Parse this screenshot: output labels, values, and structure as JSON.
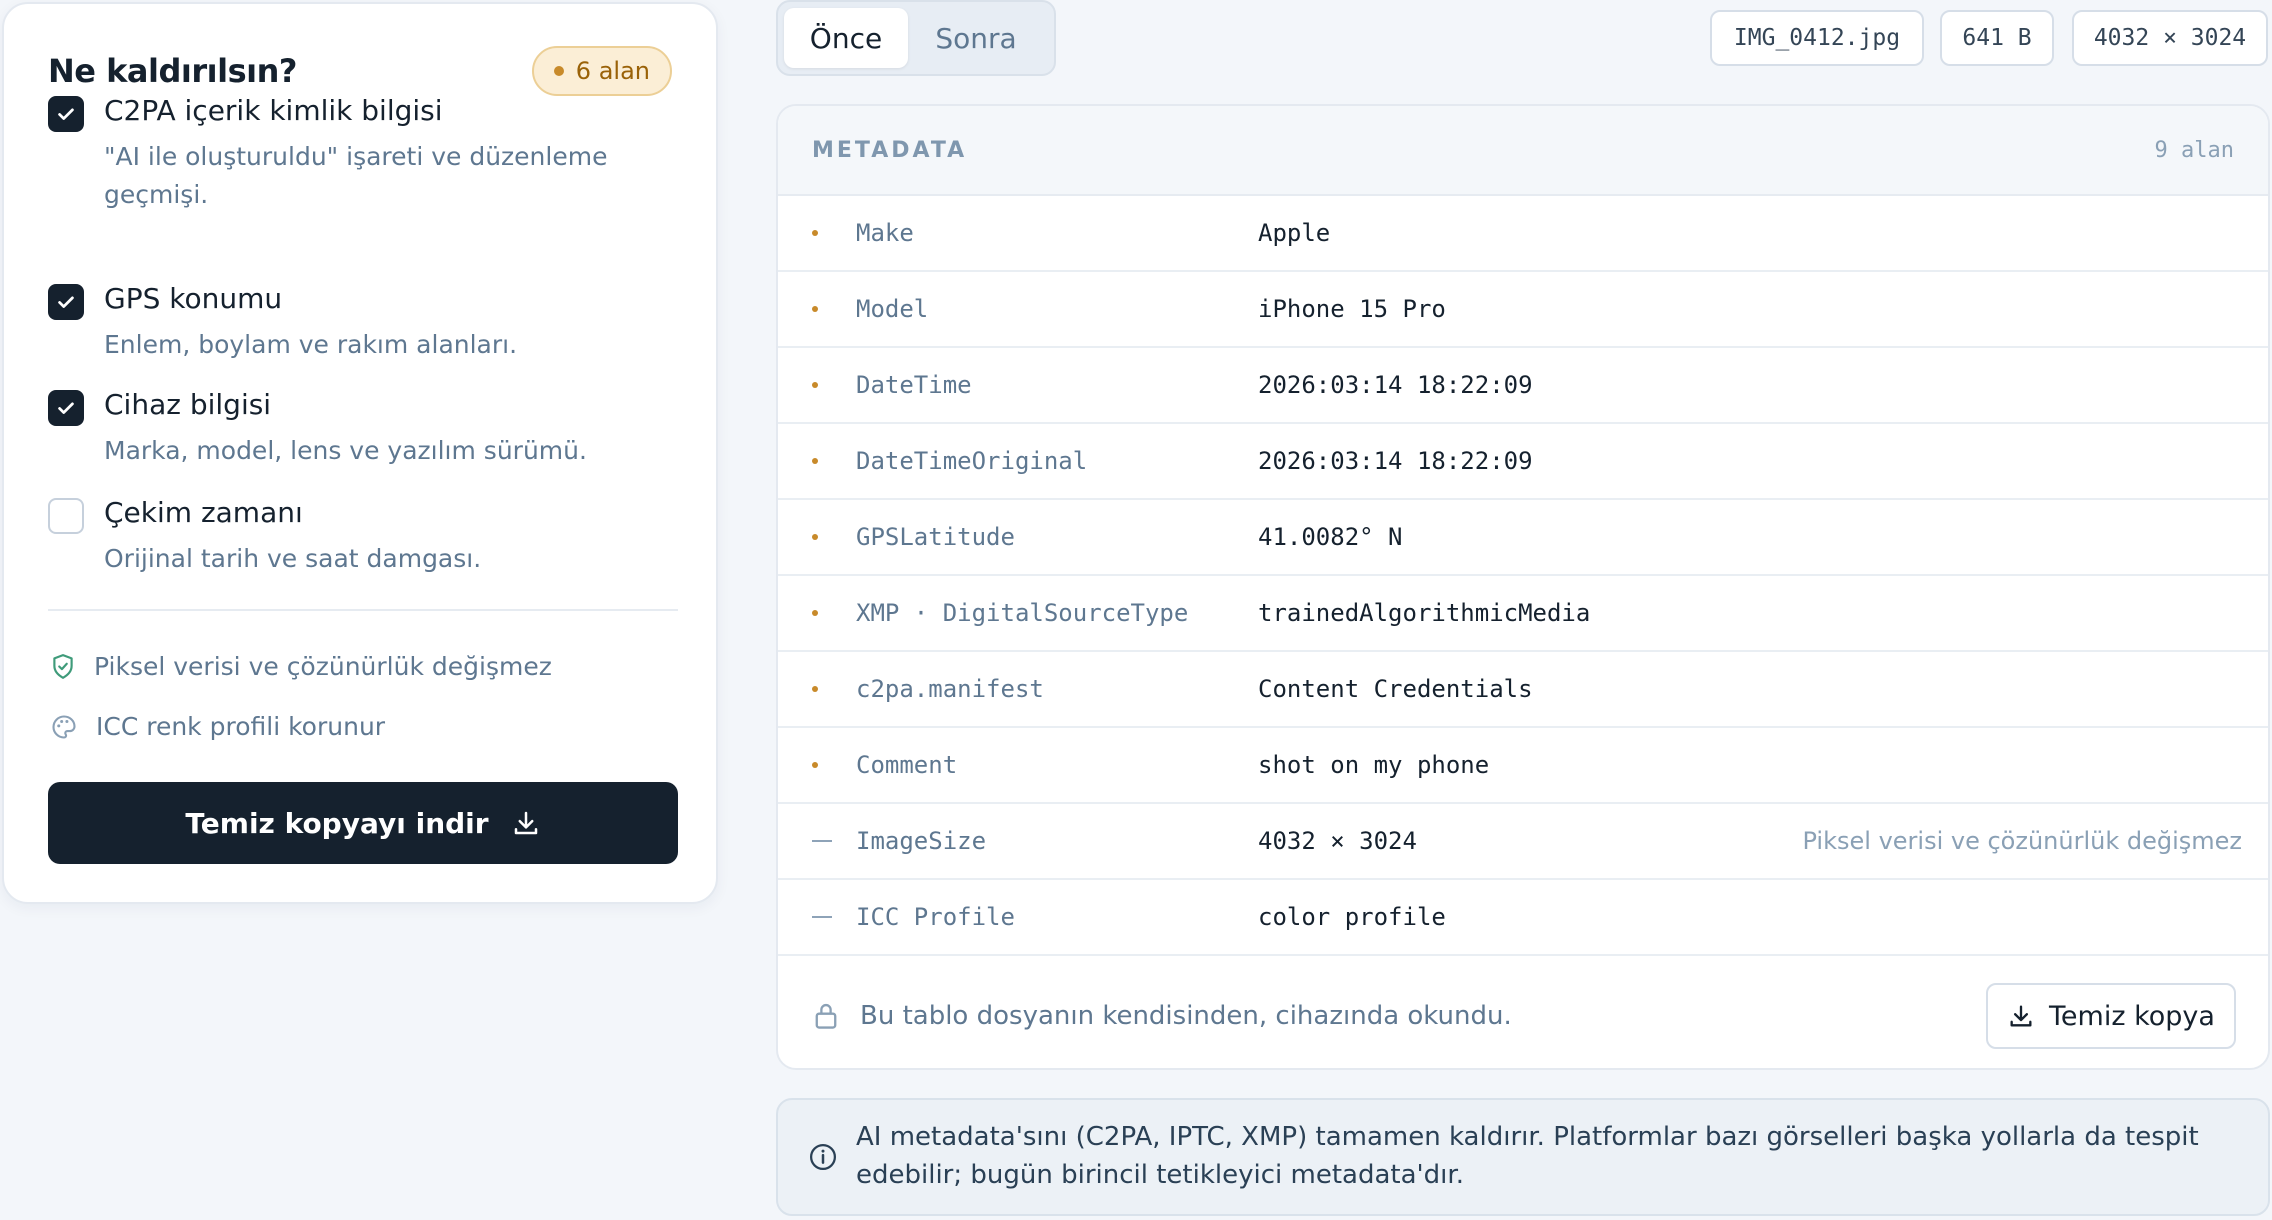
{
  "left_panel": {
    "title": "Ne kaldırılsın?",
    "count_badge": "6 alan",
    "options": [
      {
        "title": "C2PA içerik kimlik bilgisi",
        "desc": "\"AI ile oluşturuldu\" işareti ve düzenleme geçmişi.",
        "checked": true
      },
      {
        "title": "GPS konumu",
        "desc": "Enlem, boylam ve rakım alanları.",
        "checked": true
      },
      {
        "title": "Cihaz bilgisi",
        "desc": "Marka, model, lens ve yazılım sürümü.",
        "checked": true
      },
      {
        "title": "Çekim zamanı",
        "desc": "Orijinal tarih ve saat damgası.",
        "checked": false
      }
    ],
    "notes": [
      "Piksel verisi ve çözünürlük değişmez",
      "ICC renk profili korunur"
    ],
    "download_label": "Temiz kopyayı indir"
  },
  "tabs": [
    {
      "label": "Önce",
      "active": true
    },
    {
      "label": "Sonra",
      "active": false
    }
  ],
  "file_chips": {
    "name": "IMG_0412.jpg",
    "size": "641 B",
    "dims": "4032 × 3024"
  },
  "metadata": {
    "title": "METADATA",
    "count": "9 alan",
    "rows": [
      {
        "key": "Make",
        "value": "Apple",
        "marker": "dot",
        "extra": ""
      },
      {
        "key": "Model",
        "value": "iPhone 15 Pro",
        "marker": "dot",
        "extra": ""
      },
      {
        "key": "DateTime",
        "value": "2026:03:14 18:22:09",
        "marker": "dot",
        "extra": ""
      },
      {
        "key": "DateTimeOriginal",
        "value": "2026:03:14 18:22:09",
        "marker": "dot",
        "extra": ""
      },
      {
        "key": "GPSLatitude",
        "value": "41.0082° N",
        "marker": "dot",
        "extra": ""
      },
      {
        "key": "XMP · DigitalSourceType",
        "value": "trainedAlgorithmicMedia",
        "marker": "dot",
        "extra": ""
      },
      {
        "key": "c2pa.manifest",
        "value": "Content Credentials",
        "marker": "dot",
        "extra": ""
      },
      {
        "key": "Comment",
        "value": "shot on my phone",
        "marker": "dot",
        "extra": ""
      },
      {
        "key": "ImageSize",
        "value": "4032 × 3024",
        "marker": "dash",
        "extra": "Piksel verisi ve çözünürlük değişmez"
      },
      {
        "key": "ICC Profile",
        "value": "color profile",
        "marker": "dash",
        "extra": ""
      }
    ],
    "footer_note": "Bu tablo dosyanın kendisinden, cihazında okundu.",
    "clean_button": "Temiz kopya"
  },
  "info": {
    "text": "AI metadata'sını (C2PA, IPTC, XMP) tamamen kaldırır. Platformlar bazı görselleri başka yollarla da tespit edebilir; bugün birincil tetikleyici metadata'dır."
  },
  "colors": {
    "primary": "#15212e",
    "accent_amber": "#c88a2a",
    "muted_text": "#5e7790",
    "page_bg": "#f3f6fa"
  },
  "icons": {
    "check": "check-icon",
    "shield": "shield-check-icon",
    "palette": "palette-icon",
    "download": "download-icon",
    "lock": "lock-icon",
    "info": "info-icon"
  }
}
